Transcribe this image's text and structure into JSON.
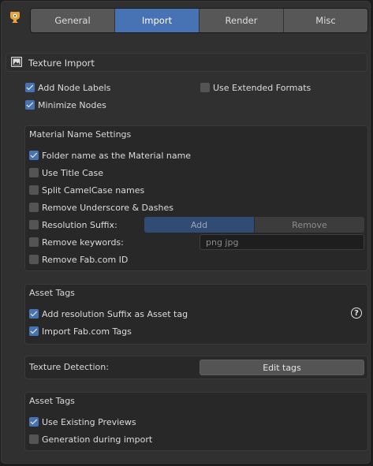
{
  "tabs": [
    {
      "label": "General",
      "active": false
    },
    {
      "label": "Import",
      "active": true
    },
    {
      "label": "Render",
      "active": false
    },
    {
      "label": "Misc",
      "active": false
    }
  ],
  "texture_import": {
    "title": "Texture Import",
    "add_node_labels": {
      "label": "Add Node Labels",
      "checked": true
    },
    "use_extended_formats": {
      "label": "Use Extended Formats",
      "checked": false
    },
    "minimize_nodes": {
      "label": "Minimize Nodes",
      "checked": true
    }
  },
  "material_name": {
    "title": "Material Name Settings",
    "folder_name": {
      "label": "Folder name as the Material name",
      "checked": true
    },
    "title_case": {
      "label": "Use Title Case",
      "checked": false
    },
    "split_camelcase": {
      "label": "Split CamelCase names",
      "checked": false
    },
    "remove_underscore": {
      "label": "Remove Underscore & Dashes",
      "checked": false
    },
    "resolution_suffix": {
      "label": "Resolution Suffix:",
      "checked": false,
      "add": "Add",
      "remove": "Remove",
      "selected": "Add"
    },
    "remove_keywords": {
      "label": "Remove keywords:",
      "checked": false,
      "placeholder": "png jpg"
    },
    "remove_fab_id": {
      "label": "Remove Fab.com ID",
      "checked": false
    }
  },
  "asset_tags": {
    "title": "Asset Tags",
    "resolution_suffix_tag": {
      "label": "Add resolution Suffix as Asset tag",
      "checked": true
    },
    "import_fab_tags": {
      "label": "Import Fab.com Tags",
      "checked": true
    },
    "help_icon": "question-circle-icon"
  },
  "texture_detection": {
    "label": "Texture Detection:",
    "button": "Edit tags"
  },
  "asset_tags_previews": {
    "title": "Asset Tags",
    "use_existing_previews": {
      "label": "Use Existing Previews",
      "checked": true
    },
    "generation_during_import": {
      "label": "Generation during import",
      "checked": false
    }
  },
  "colors": {
    "accent": "#4772b3",
    "panel": "#303030",
    "box": "#282828"
  }
}
